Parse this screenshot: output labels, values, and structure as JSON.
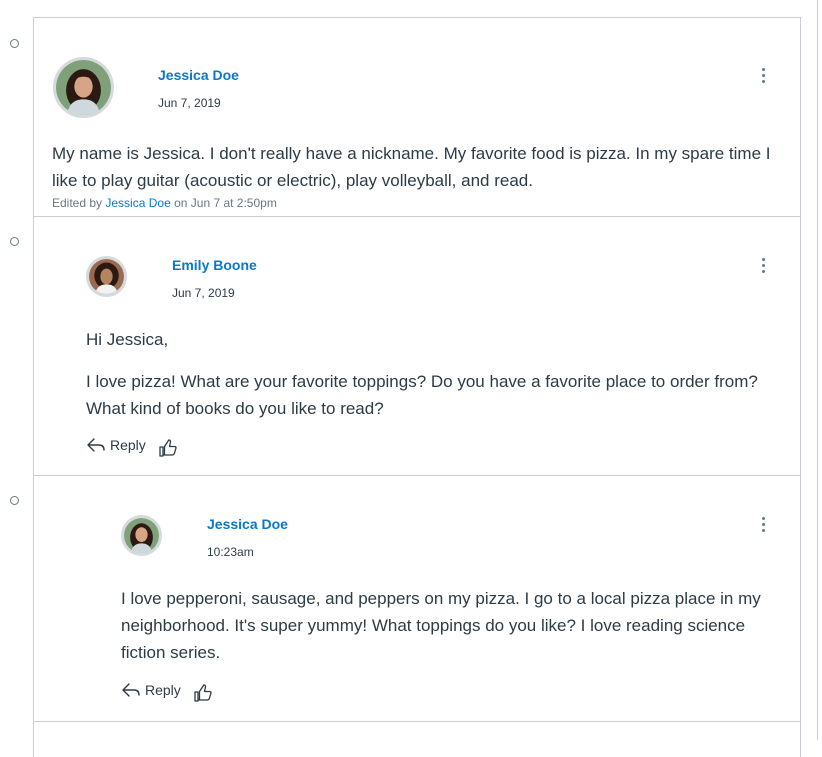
{
  "posts": [
    {
      "author": "Jessica Doe",
      "date": "Jun 7, 2019",
      "paragraphs": [
        "My name is Jessica. I don't really have a nickname. My favorite food is pizza. In my spare time I like to play guitar (acoustic or electric), play volleyball, and read."
      ],
      "edited_prefix": "Edited by ",
      "edited_author": "Jessica Doe",
      "edited_suffix": " on Jun 7 at 2:50pm"
    },
    {
      "author": "Emily Boone",
      "date": "Jun 7, 2019",
      "paragraphs": [
        "Hi Jessica,",
        "I love pizza! What are your favorite toppings? Do you have a favorite place to order from? What kind of books do you like to read?"
      ],
      "reply_label": "Reply"
    },
    {
      "author": "Jessica Doe",
      "date": "10:23am",
      "paragraphs": [
        "I love pepperoni, sausage, and peppers on my pizza. I go to a local pizza place in my neighborhood. It's super yummy! What toppings do you like? I love reading science fiction series."
      ],
      "reply_label": "Reply"
    }
  ],
  "colors": {
    "link": "#0b78c6",
    "text": "#2d3b45",
    "muted": "#6b7780",
    "border": "#c7cdd1"
  },
  "icons": [
    "unread-indicator-icon",
    "kebab-menu-icon",
    "reply-arrow-icon",
    "thumbs-up-icon"
  ]
}
